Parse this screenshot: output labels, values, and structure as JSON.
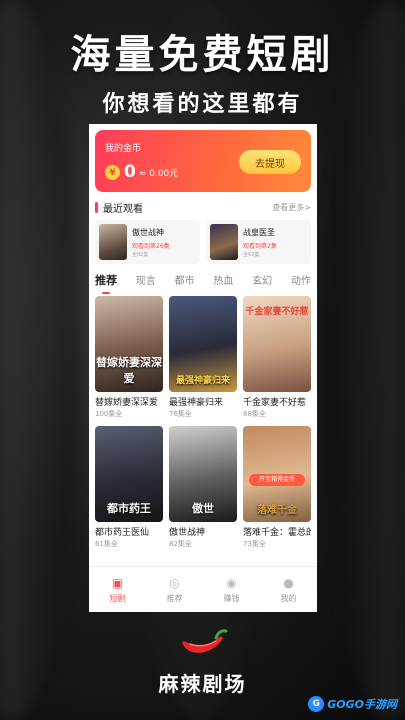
{
  "promo": {
    "headline": "海量免费短剧",
    "subline": "你想看的这里都有"
  },
  "coins": {
    "title": "我的金币",
    "icon_glyph": "¥",
    "value": "0",
    "equivalent": "≈ 0.00元",
    "withdraw_label": "去提现"
  },
  "recent": {
    "title": "最近观看",
    "see_more": "查看更多>",
    "items": [
      {
        "name": "傲世战神",
        "progress": "观看到第26集",
        "total": "全82集"
      },
      {
        "name": "战皇医圣",
        "progress": "观看到第2集",
        "total": "全69集"
      }
    ]
  },
  "tabs": [
    "推荐",
    "现言",
    "都市",
    "热血",
    "玄幻",
    "动作"
  ],
  "dramas": [
    {
      "title": "替嫁娇妻深深爱",
      "episodes": "100集全",
      "poster_text": "替嫁娇妻深深爱"
    },
    {
      "title": "最强神豪归来",
      "episodes": "76集全",
      "poster_text": "最强神豪归来"
    },
    {
      "title": "千金家妻不好惹",
      "episodes": "88集全",
      "poster_text": "千金家妻不好惹"
    },
    {
      "title": "都市药王医仙",
      "episodes": "61集全",
      "poster_text": "都市药王"
    },
    {
      "title": "傲世战神",
      "episodes": "82集全",
      "poster_text": "傲世"
    },
    {
      "title": "落难千金：霍总的心尖宠",
      "episodes": "73集全",
      "poster_text": "落难千金",
      "badge": "开宝箱得金币"
    }
  ],
  "nav": [
    {
      "label": "短剧",
      "icon": "film-icon",
      "glyph": "▣"
    },
    {
      "label": "推荐",
      "icon": "discover-icon",
      "glyph": "◎"
    },
    {
      "label": "赚钱",
      "icon": "money-bag-icon",
      "glyph": "◉"
    },
    {
      "label": "我的",
      "icon": "profile-icon",
      "glyph": "●"
    }
  ],
  "brand": {
    "app_name": "麻辣剧场",
    "watermark": "GOGO手游网",
    "watermark_glyph": "G",
    "accent_color": "#ff3d5a",
    "coin_gradient_end": "#ff8a3a"
  }
}
